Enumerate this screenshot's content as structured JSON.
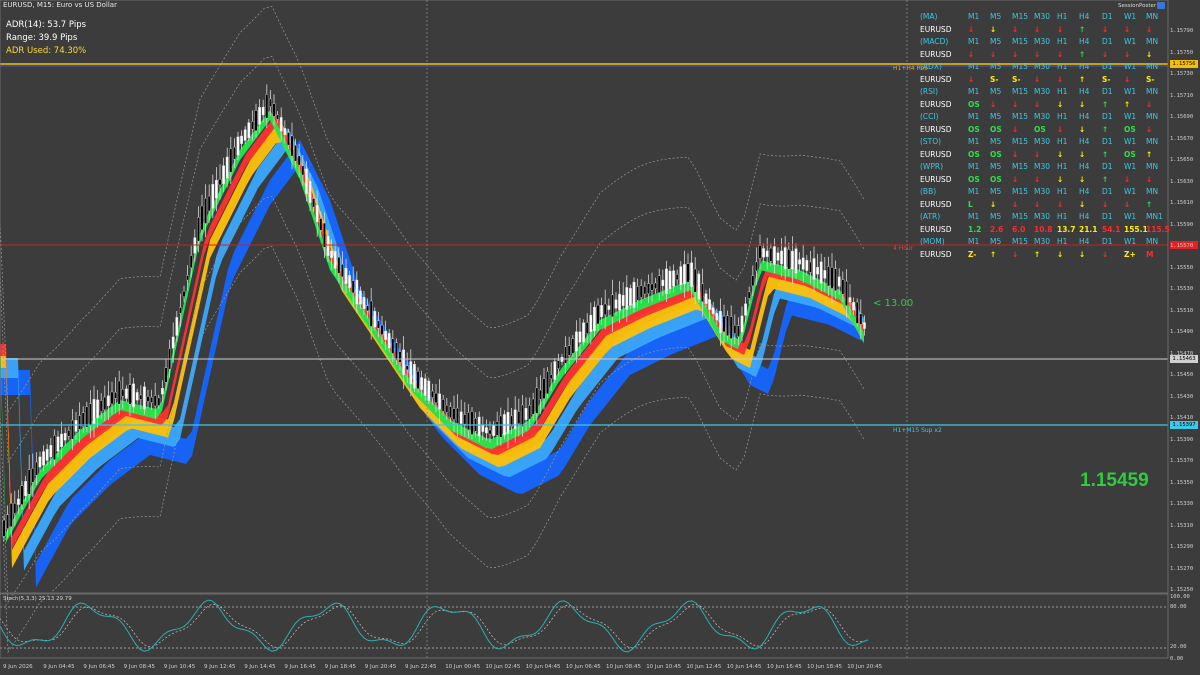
{
  "window": {
    "title": "EURUSD, M15:  Euro vs US Dollar"
  },
  "info": {
    "adr": "ADR(14):  53.7 Pips",
    "range": "Range:  39.9 Pips",
    "adr_used": "ADR Used:  74.30%"
  },
  "current_price": "1.15459",
  "pips_label": "< 13.00",
  "session_label": "SessionPoster",
  "levels": {
    "res_label": "H1+H4 Res",
    "res_price": "1.15756",
    "mid_label": "4 Hour",
    "cur_price": "1.15463",
    "sup_label": "H1+M15 Sup x2",
    "sup_price": "1.15397"
  },
  "price_axis": [
    "1.15790",
    "1.15750",
    "1.15730",
    "1.15710",
    "1.15690",
    "1.15670",
    "1.15650",
    "1.15630",
    "1.15610",
    "1.15590",
    "1.15570",
    "1.15550",
    "1.15530",
    "1.15510",
    "1.15490",
    "1.15470",
    "1.15450",
    "1.15430",
    "1.15410",
    "1.15390",
    "1.15370",
    "1.15350",
    "1.15330",
    "1.15310",
    "1.15290",
    "1.15270",
    "1.15250"
  ],
  "time_axis": [
    "9 Jun 2026",
    "9 Jun 04:45",
    "9 Jun 06:45",
    "9 Jun 08:45",
    "9 Jun 10:45",
    "9 Jun 12:45",
    "9 Jun 14:45",
    "9 Jun 16:45",
    "9 Jun 18:45",
    "9 Jun 20:45",
    "9 Jun 22:45",
    "10 Jun 00:45",
    "10 Jun 02:45",
    "10 Jun 04:45",
    "10 Jun 06:45",
    "10 Jun 08:45",
    "10 Jun 10:45",
    "10 Jun 12:45",
    "10 Jun 14:45",
    "10 Jun 16:45",
    "10 Jun 18:45",
    "10 Jun 20:45"
  ],
  "stoch": {
    "label": "Stoch(5,3,3) 25.13 29.79",
    "axis": [
      "100.00",
      "80.00",
      "20.00",
      "0.00"
    ]
  },
  "table": {
    "headers": [
      "M1",
      "M5",
      "M15",
      "M30",
      "H1",
      "H4",
      "D1",
      "W1",
      "MN"
    ],
    "sections": [
      {
        "name": "(MA)",
        "hdr": [
          "M1",
          "M5",
          "M15",
          "M30",
          "H1",
          "H4",
          "D1",
          "W1",
          "MN"
        ],
        "sym": "EURUSD",
        "cells": [
          [
            "↓",
            "r"
          ],
          [
            "↓",
            "y"
          ],
          [
            "↓",
            "r"
          ],
          [
            "↓",
            "r"
          ],
          [
            "↓",
            "r"
          ],
          [
            "↑",
            "g"
          ],
          [
            "↓",
            "r"
          ],
          [
            "↓",
            "r"
          ],
          [
            "↓",
            "r"
          ]
        ]
      },
      {
        "name": "(MACD)",
        "hdr": [
          "M1",
          "M5",
          "M15",
          "M30",
          "H1",
          "H4",
          "D1",
          "W1",
          "MN"
        ],
        "sym": "EURUSD",
        "cells": [
          [
            "↓",
            "r"
          ],
          [
            "↓",
            "r"
          ],
          [
            "↓",
            "r"
          ],
          [
            "↓",
            "r"
          ],
          [
            "↓",
            "r"
          ],
          [
            "↑",
            "g"
          ],
          [
            "↓",
            "r"
          ],
          [
            "↓",
            "r"
          ],
          [
            "↓",
            "y"
          ]
        ]
      },
      {
        "name": "(ADX)",
        "hdr": [
          "M1",
          "M5",
          "M15",
          "M30",
          "H1",
          "H4",
          "D1",
          "W1",
          "MN"
        ],
        "sym": "EURUSD",
        "cells": [
          [
            "↓",
            "r"
          ],
          [
            "S-",
            "y"
          ],
          [
            "S-",
            "y"
          ],
          [
            "↓",
            "r"
          ],
          [
            "↓",
            "r"
          ],
          [
            "↑",
            "y"
          ],
          [
            "S-",
            "y"
          ],
          [
            "↓",
            "r"
          ],
          [
            "S-",
            "y"
          ]
        ]
      },
      {
        "name": "(RSI)",
        "hdr": [
          "M1",
          "M5",
          "M15",
          "M30",
          "H1",
          "H4",
          "D1",
          "W1",
          "MN"
        ],
        "sym": "EURUSD",
        "cells": [
          [
            "OS",
            "g"
          ],
          [
            "↓",
            "r"
          ],
          [
            "↓",
            "r"
          ],
          [
            "↓",
            "r"
          ],
          [
            "↓",
            "y"
          ],
          [
            "↓",
            "y"
          ],
          [
            "↑",
            "g"
          ],
          [
            "↑",
            "y"
          ],
          [
            "↓",
            "r"
          ]
        ]
      },
      {
        "name": "(CCI)",
        "hdr": [
          "M1",
          "M5",
          "M15",
          "M30",
          "H1",
          "H4",
          "D1",
          "W1",
          "MN"
        ],
        "sym": "EURUSD",
        "cells": [
          [
            "OS",
            "g"
          ],
          [
            "OS",
            "g"
          ],
          [
            "↓",
            "r"
          ],
          [
            "OS",
            "g"
          ],
          [
            "↓",
            "r"
          ],
          [
            "↓",
            "y"
          ],
          [
            "↑",
            "g"
          ],
          [
            "OS",
            "g"
          ],
          [
            "↓",
            "r"
          ]
        ]
      },
      {
        "name": "(STO)",
        "hdr": [
          "M1",
          "M5",
          "M15",
          "M30",
          "H1",
          "H4",
          "D1",
          "W1",
          "MN"
        ],
        "sym": "EURUSD",
        "cells": [
          [
            "OS",
            "g"
          ],
          [
            "OS",
            "g"
          ],
          [
            "↓",
            "r"
          ],
          [
            "↓",
            "r"
          ],
          [
            "↓",
            "y"
          ],
          [
            "↓",
            "y"
          ],
          [
            "↑",
            "g"
          ],
          [
            "OS",
            "g"
          ],
          [
            "↑",
            "y"
          ]
        ]
      },
      {
        "name": "(WPR)",
        "hdr": [
          "M1",
          "M5",
          "M15",
          "M30",
          "H1",
          "H4",
          "D1",
          "W1",
          "MN"
        ],
        "sym": "EURUSD",
        "cells": [
          [
            "OS",
            "g"
          ],
          [
            "OS",
            "g"
          ],
          [
            "↓",
            "r"
          ],
          [
            "↓",
            "r"
          ],
          [
            "↓",
            "y"
          ],
          [
            "↓",
            "y"
          ],
          [
            "↑",
            "g"
          ],
          [
            "↓",
            "r"
          ],
          [
            "↓",
            "r"
          ]
        ]
      },
      {
        "name": "(BB)",
        "hdr": [
          "M1",
          "M5",
          "M15",
          "M30",
          "H1",
          "H4",
          "D1",
          "W1",
          "MN"
        ],
        "sym": "EURUSD",
        "cells": [
          [
            "L",
            "g"
          ],
          [
            "↓",
            "y"
          ],
          [
            "↓",
            "r"
          ],
          [
            "↓",
            "r"
          ],
          [
            "↓",
            "r"
          ],
          [
            "↓",
            "y"
          ],
          [
            "↓",
            "r"
          ],
          [
            "↓",
            "r"
          ],
          [
            "↑",
            "g"
          ]
        ]
      },
      {
        "name": "(ATR)",
        "hdr": [
          "M1",
          "M5",
          "M15",
          "M30",
          "H1",
          "H4",
          "D1",
          "W1",
          "MN1"
        ],
        "sym": "EURUSD",
        "cells": [
          [
            "1.2",
            "g"
          ],
          [
            "2.6",
            "r"
          ],
          [
            "6.0",
            "r"
          ],
          [
            "10.8",
            "r"
          ],
          [
            "13.7",
            "y"
          ],
          [
            "21.1",
            "y"
          ],
          [
            "54.1",
            "r"
          ],
          [
            "155.1",
            "y"
          ],
          [
            "115.5",
            "r"
          ]
        ]
      },
      {
        "name": "(MOM)",
        "hdr": [
          "M1",
          "M5",
          "M15",
          "M30",
          "H1",
          "H4",
          "D1",
          "W1",
          "MN"
        ],
        "sym": "EURUSD",
        "cells": [
          [
            "Z-",
            "y"
          ],
          [
            "↑",
            "y"
          ],
          [
            "↓",
            "r"
          ],
          [
            "↑",
            "y"
          ],
          [
            "↓",
            "y"
          ],
          [
            "↓",
            "y"
          ],
          [
            "↓",
            "r"
          ],
          [
            "Z+",
            "y"
          ],
          [
            "M",
            "r"
          ]
        ]
      }
    ]
  },
  "colors": {
    "bg": "#3c3c3c",
    "up_candle": "#ffffff",
    "down_candle": "#000000",
    "header_cyan": "#3cc8e6",
    "arrow_red": "#ff2a2a",
    "arrow_green": "#2ee04a",
    "arrow_yellow": "#ffee00"
  }
}
